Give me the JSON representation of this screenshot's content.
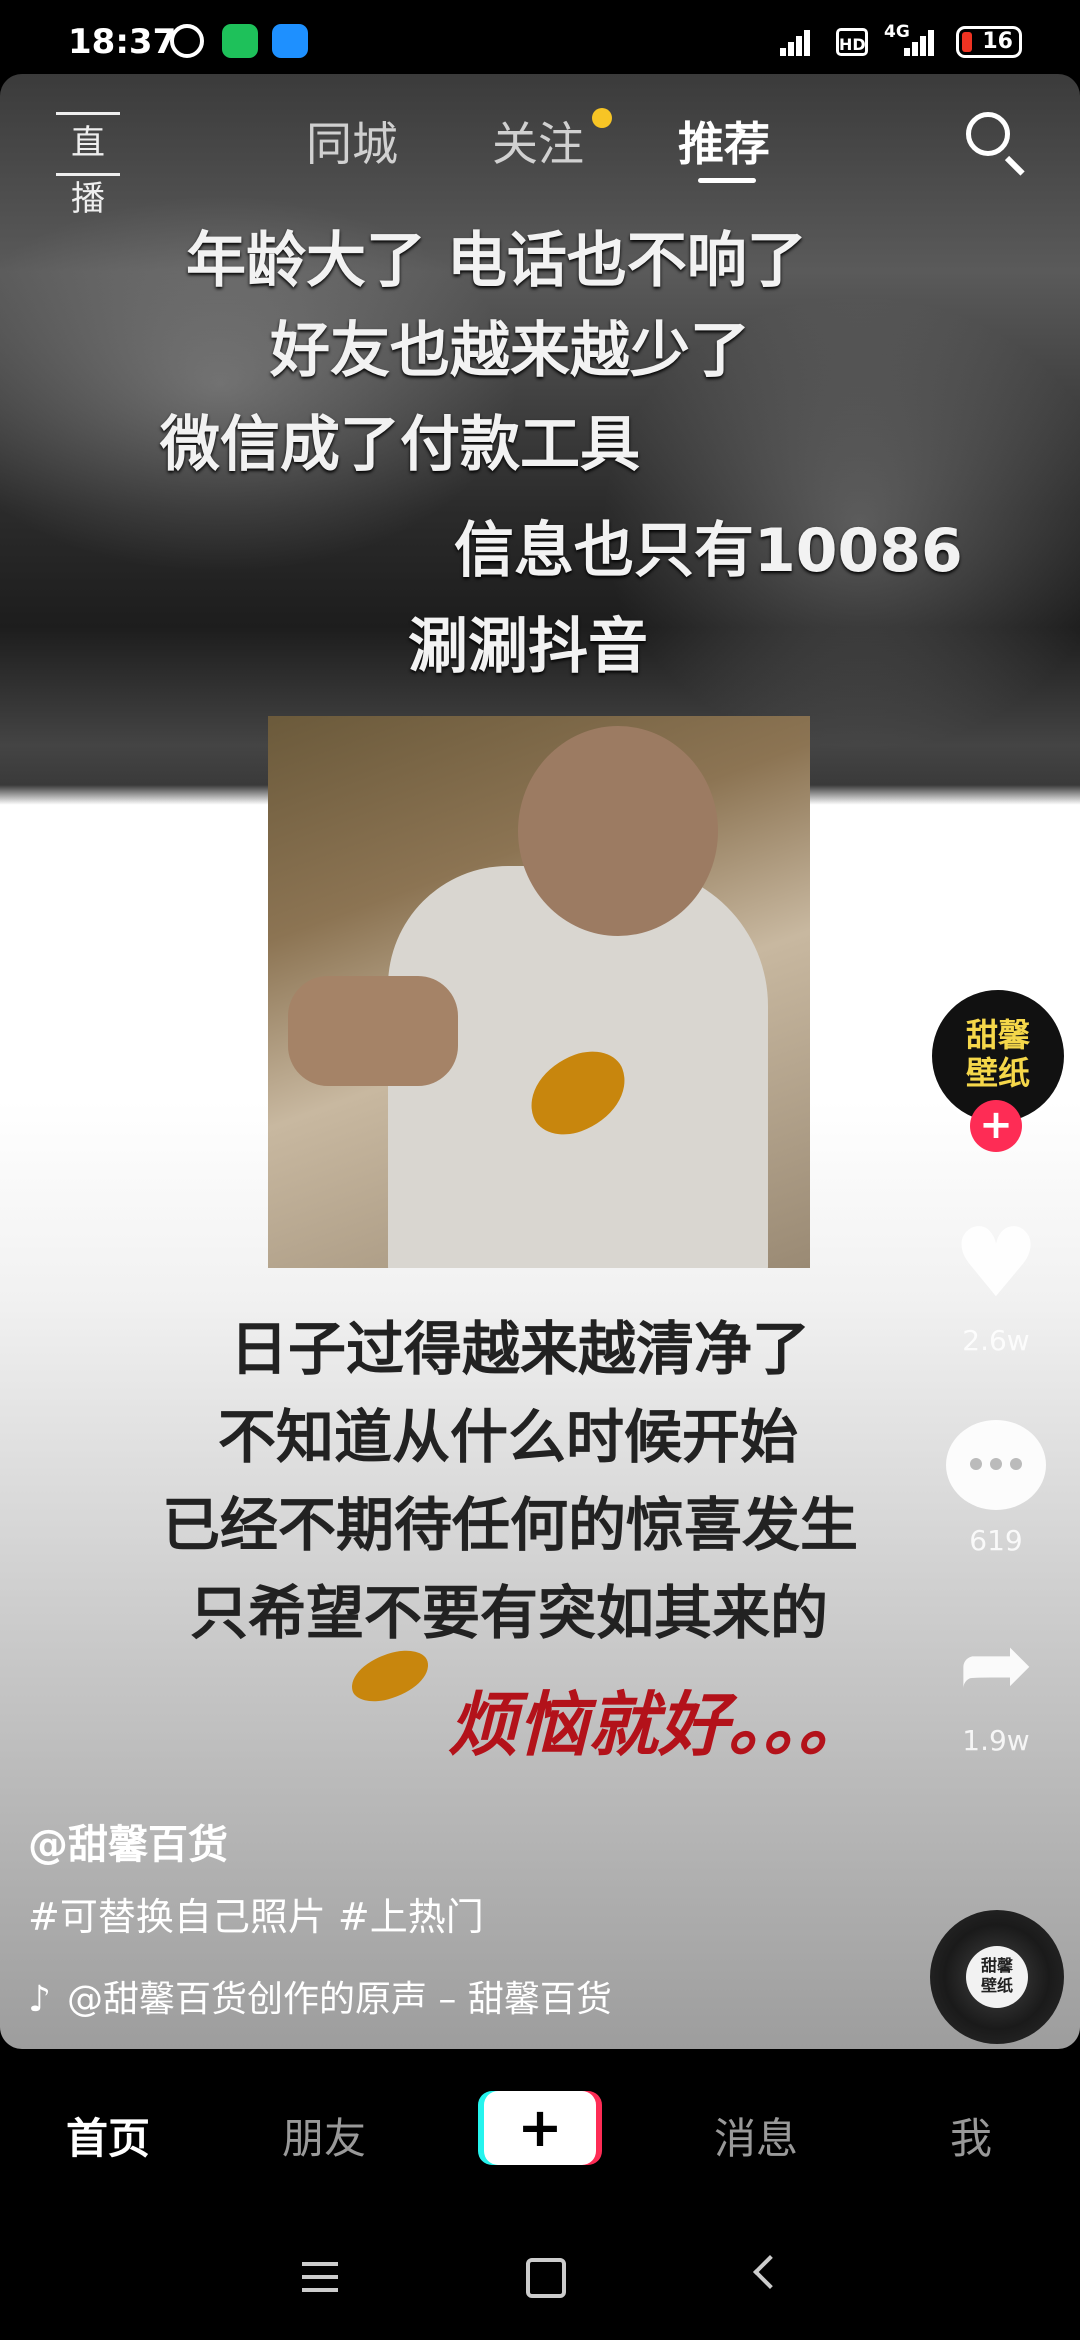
{
  "status_bar": {
    "time": "18:37",
    "hd_label": "HD",
    "network": "4G",
    "battery": "16",
    "icons": [
      "alarm-icon",
      "wechat-icon",
      "message-app-icon",
      "signal-icon",
      "signal-icon"
    ]
  },
  "top_nav": {
    "live": "直播",
    "tabs": [
      {
        "label": "同城"
      },
      {
        "label": "关注",
        "has_dot": true
      },
      {
        "label": "推荐",
        "active": true
      }
    ],
    "search_icon": "search-icon"
  },
  "video": {
    "caption_top": [
      "年龄大了  电话也不响了",
      "好友也越来越少了",
      "微信成了付款工具",
      "信息也只有10086",
      "涮涮抖音"
    ],
    "caption_bottom": [
      "日子过得越来越清净了",
      "不知道从什么时候开始",
      "已经不期待任何的惊喜发生",
      "只希望不要有突如其来的"
    ],
    "caption_red": "烦恼就好。。。",
    "author": "@甜馨百货",
    "tags": "#可替换自己照片 #上热门",
    "music": "@甜馨百货创作的原声 – 甜馨百货"
  },
  "actions": {
    "avatar_text": [
      "甜馨",
      "壁纸"
    ],
    "likes": "2.6w",
    "comments": "619",
    "shares": "1.9w",
    "disc_text": [
      "甜馨",
      "壁纸"
    ]
  },
  "bottom_tabs": [
    {
      "label": "首页",
      "active": true
    },
    {
      "label": "朋友"
    },
    {
      "label": "+"
    },
    {
      "label": "消息"
    },
    {
      "label": "我"
    }
  ],
  "colors": {
    "accent_red": "#fe2c55",
    "accent_cyan": "#25f4ee",
    "notify_dot": "#f7c525",
    "caption_red": "#b3121a"
  }
}
